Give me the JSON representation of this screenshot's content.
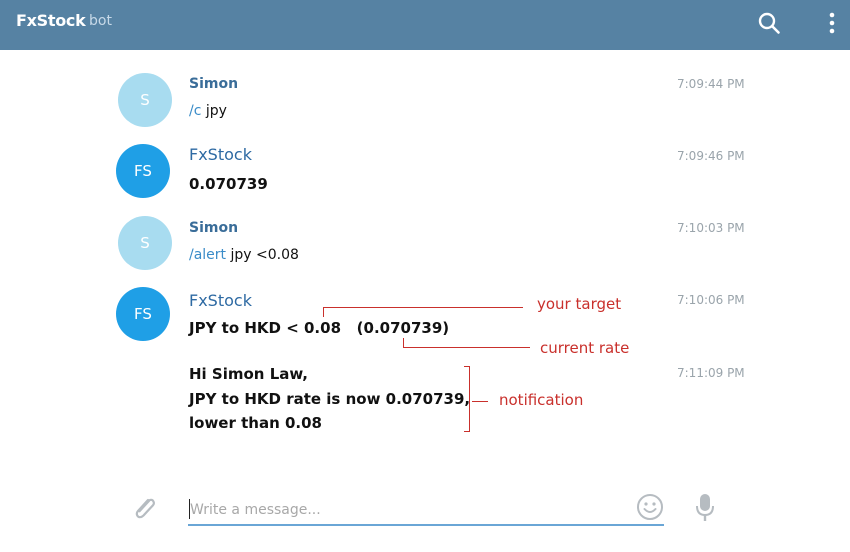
{
  "header": {
    "title": "FxStock",
    "subtitle": "bot",
    "search_icon": "search-icon",
    "more_icon": "more-vertical-icon"
  },
  "messages": [
    {
      "avatar_initial": "S",
      "sender": "Simon",
      "time": "7:09:44 PM",
      "command": "/c",
      "text": " jpy"
    },
    {
      "avatar_initial": "FS",
      "sender": "FxStock",
      "time": "7:09:46 PM",
      "text": "0.070739"
    },
    {
      "avatar_initial": "S",
      "sender": "Simon",
      "time": "7:10:03 PM",
      "command": "/alert",
      "text": " jpy <0.08"
    },
    {
      "avatar_initial": "FS",
      "sender": "FxStock",
      "time": "7:10:06 PM",
      "text": "JPY to HKD < 0.08   (0.070739)"
    },
    {
      "time": "7:11:09 PM",
      "lines": [
        "Hi Simon Law,",
        "JPY to HKD rate is now 0.070739,",
        "lower than 0.08"
      ]
    }
  ],
  "annotations": {
    "target": "your target",
    "current": "current rate",
    "notification": "notification"
  },
  "composer": {
    "placeholder": "Write a message...",
    "attach_icon": "paperclip-icon",
    "emoji_icon": "emoji-icon",
    "mic_icon": "microphone-icon"
  },
  "colors": {
    "header_bg": "#5682a3",
    "avatar_user": "#a8dcf0",
    "avatar_bot": "#1f9fe6",
    "annotation": "#c9302c"
  }
}
